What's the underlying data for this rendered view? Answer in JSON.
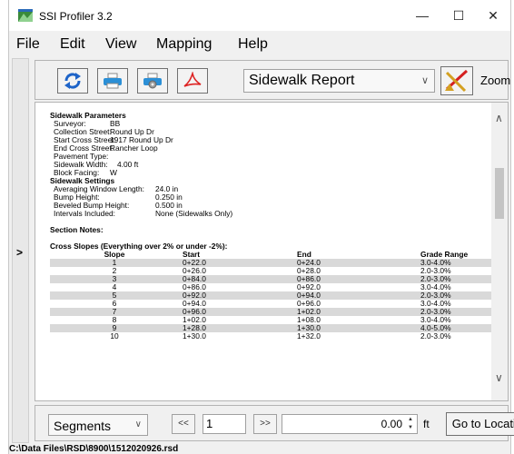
{
  "window": {
    "title": "SSI Profiler 3.2",
    "minimize": "—",
    "maximize": "☐",
    "close": "✕"
  },
  "menu": [
    "File",
    "Edit",
    "View",
    "Mapping",
    "Help"
  ],
  "toolbar": {
    "report_selected": "Sidewalk Report",
    "zoom_label": "Zoom"
  },
  "left_panel": {
    "expand": ">"
  },
  "report": {
    "params_heading": "Sidewalk Parameters",
    "params": [
      {
        "k": "Surveyor:",
        "v": "BB"
      },
      {
        "k": "Collection Street:",
        "v": "Round Up Dr"
      },
      {
        "k": "Start Cross Street:",
        "v": "1917 Round Up Dr"
      },
      {
        "k": "End Cross Street:",
        "v": "Rancher Loop"
      },
      {
        "k": "Pavement Type:",
        "v": ""
      },
      {
        "k": "Sidewalk Width:",
        "v": "4.00 ft"
      },
      {
        "k": "Block Facing:",
        "v": "W"
      }
    ],
    "settings_heading": "Sidewalk Settings",
    "settings": [
      {
        "k": "Averaging Window Length:",
        "v": "24.0 in"
      },
      {
        "k": "Bump Height:",
        "v": "0.250 in"
      },
      {
        "k": "Beveled Bump Height:",
        "v": "0.500 in"
      },
      {
        "k": "Intervals Included:",
        "v": "None (Sidewalks Only)"
      }
    ],
    "notes_heading": "Section Notes:",
    "cross_heading": "Cross Slopes (Everything over 2% or under -2%):",
    "columns": [
      "Slope",
      "Start",
      "End",
      "Grade Range"
    ],
    "rows": [
      [
        "1",
        "0+22.0",
        "0+24.0",
        "3.0-4.0%"
      ],
      [
        "2",
        "0+26.0",
        "0+28.0",
        "2.0-3.0%"
      ],
      [
        "3",
        "0+84.0",
        "0+86.0",
        "2.0-3.0%"
      ],
      [
        "4",
        "0+86.0",
        "0+92.0",
        "3.0-4.0%"
      ],
      [
        "5",
        "0+92.0",
        "0+94.0",
        "2.0-3.0%"
      ],
      [
        "6",
        "0+94.0",
        "0+96.0",
        "3.0-4.0%"
      ],
      [
        "7",
        "0+96.0",
        "1+02.0",
        "2.0-3.0%"
      ],
      [
        "8",
        "1+02.0",
        "1+08.0",
        "3.0-4.0%"
      ],
      [
        "9",
        "1+28.0",
        "1+30.0",
        "4.0-5.0%"
      ],
      [
        "10",
        "1+30.0",
        "1+32.0",
        "2.0-3.0%"
      ]
    ]
  },
  "bottom": {
    "mode": "Segments",
    "prev": "<<",
    "page": "1",
    "next": ">>",
    "distance": "0.00",
    "unit": "ft",
    "goto": "Go to Location"
  },
  "status": "C:\\Data Files\\RSD\\8900\\1512020926.rsd"
}
